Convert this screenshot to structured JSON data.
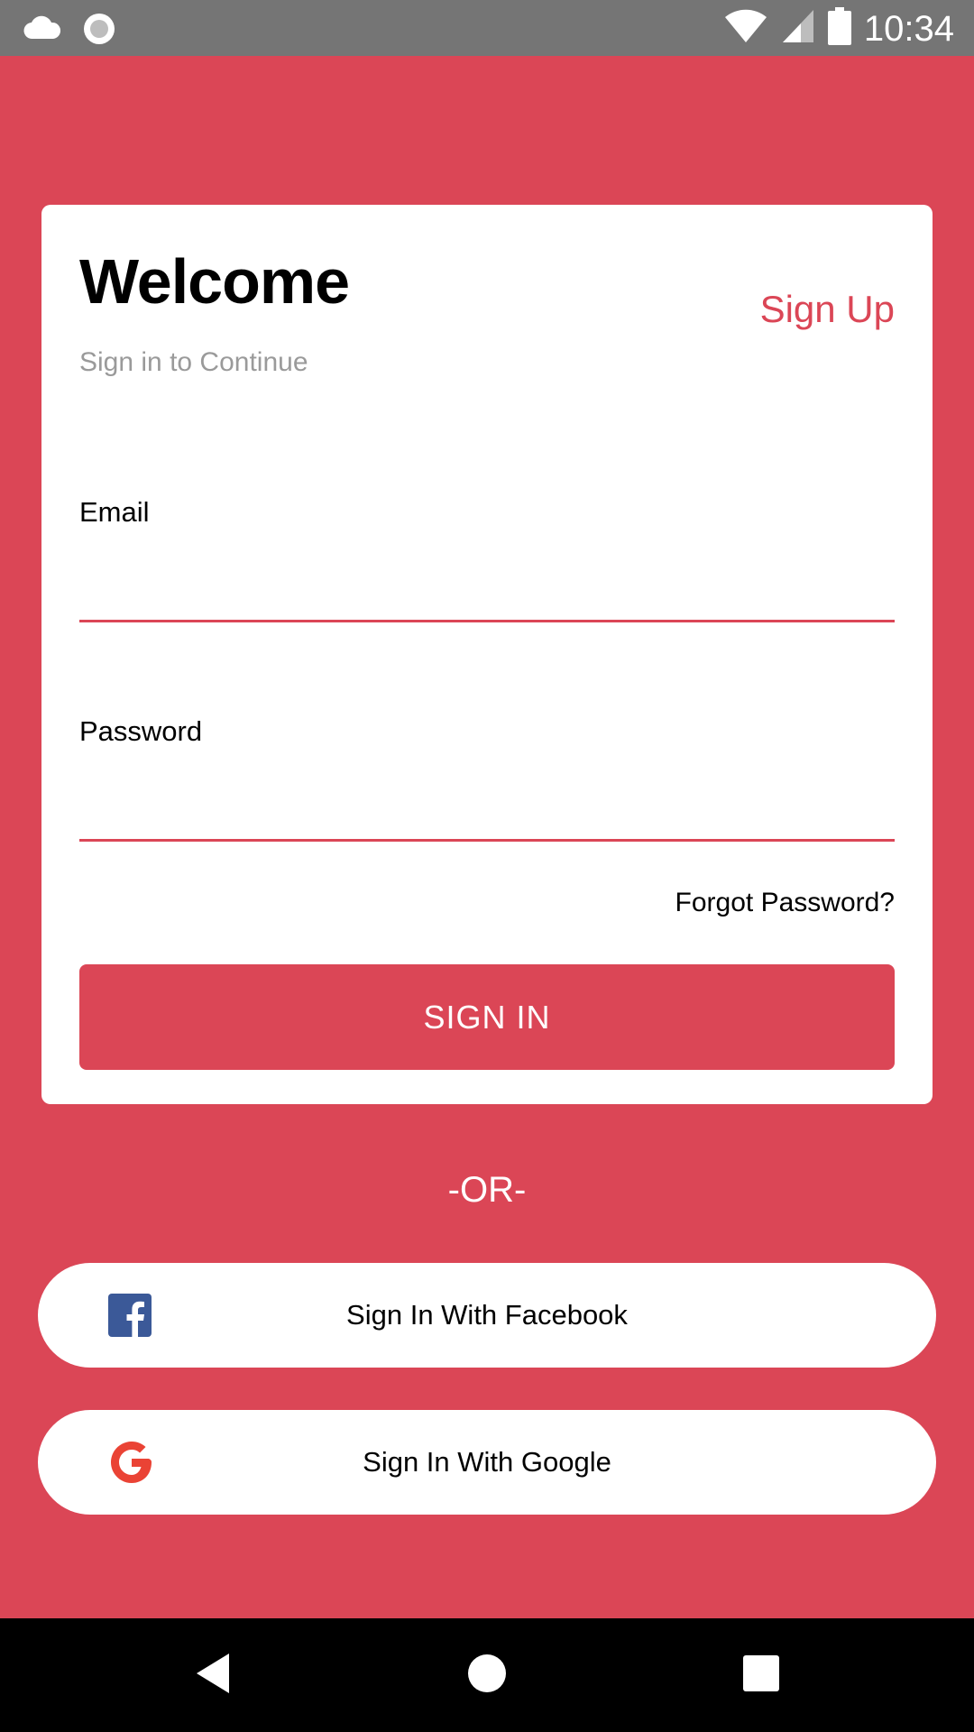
{
  "status_bar": {
    "time": "10:34",
    "left_icons": [
      "cloud-icon",
      "circle-icon"
    ],
    "right_icons": [
      "wifi-icon",
      "signal-icon",
      "battery-icon"
    ]
  },
  "card": {
    "title": "Welcome",
    "subtitle": "Sign in to Continue",
    "signup_label": "Sign Up",
    "email": {
      "label": "Email",
      "value": ""
    },
    "password": {
      "label": "Password",
      "value": ""
    },
    "forgot_label": "Forgot Password?",
    "signin_label": "SIGN IN"
  },
  "divider_text": "-OR-",
  "social": {
    "facebook_label": "Sign In With Facebook",
    "google_label": "Sign In With Google"
  },
  "nav_bar": {
    "icons": [
      "back-icon",
      "home-icon",
      "recents-icon"
    ]
  },
  "colors": {
    "accent": "#db4656",
    "status_bar": "#757575",
    "facebook": "#3b5998",
    "google": "#ea4335"
  }
}
